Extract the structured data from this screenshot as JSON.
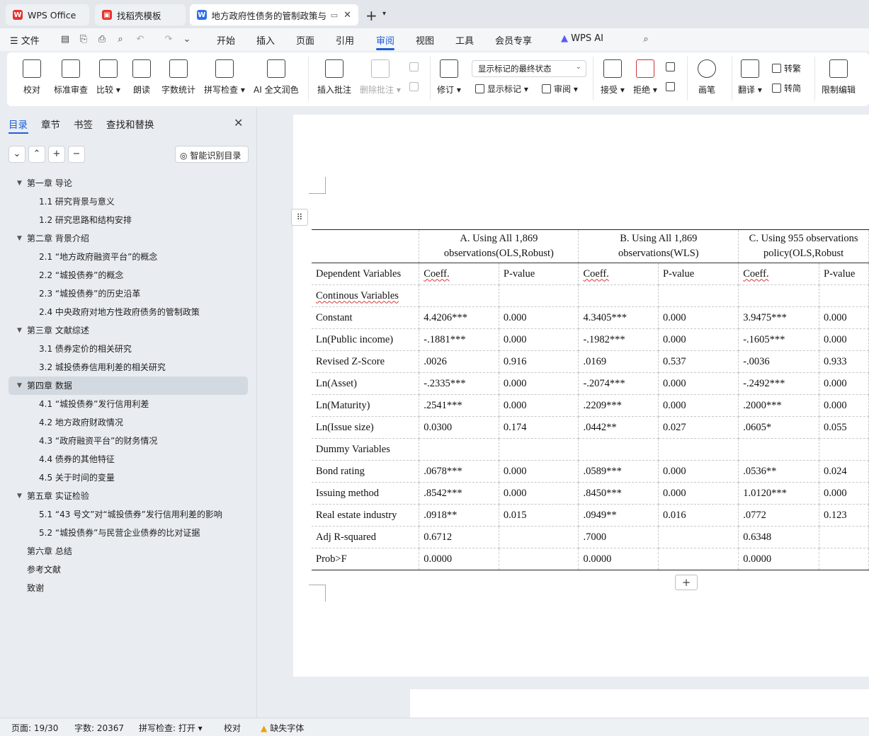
{
  "tabs": {
    "wps_office": "WPS Office",
    "template": "找稻壳模板",
    "document": "地方政府性债务的管制政策与"
  },
  "menu": {
    "file": "文件",
    "items": [
      "开始",
      "插入",
      "页面",
      "引用",
      "审阅",
      "视图",
      "工具",
      "会员专享"
    ],
    "wps_ai": "WPS AI"
  },
  "ribbon": {
    "proofread": "校对",
    "standard_review": "标准审查",
    "compare": "比较",
    "read_aloud": "朗读",
    "word_count": "字数统计",
    "spell_check": "拼写检查",
    "ai_polish": "AI 全文润色",
    "insert_comment": "插入批注",
    "delete_comment": "删除批注",
    "track_changes": "修订",
    "markup_select": "显示标记的最终状态",
    "show_markup": "显示标记",
    "review": "审阅",
    "accept": "接受",
    "reject": "拒绝",
    "brush": "画笔",
    "translate": "翻译",
    "to_traditional": "转繁",
    "to_simplified": "转简",
    "restrict_edit": "限制编辑"
  },
  "sidebar": {
    "tabs": [
      "目录",
      "章节",
      "书签",
      "查找和替换"
    ],
    "ai_toc": "智能识别目录",
    "toc": [
      {
        "level": 1,
        "text": "第一章  导论"
      },
      {
        "level": 2,
        "text": "1.1  研究背景与意义"
      },
      {
        "level": 2,
        "text": "1.2  研究思路和结构安排"
      },
      {
        "level": 1,
        "text": "第二章  背景介绍"
      },
      {
        "level": 2,
        "text": "2.1 “地方政府融资平台”的概念"
      },
      {
        "level": 2,
        "text": "2.2 “城投债券”的概念"
      },
      {
        "level": 2,
        "text": "2.3 “城投债券”的历史沿革"
      },
      {
        "level": 2,
        "text": "2.4 中央政府对地方性政府债务的管制政策"
      },
      {
        "level": 1,
        "text": "第三章  文献综述"
      },
      {
        "level": 2,
        "text": "3.1  债券定价的相关研究"
      },
      {
        "level": 2,
        "text": "3.2  城投债券信用利差的相关研究"
      },
      {
        "level": 1,
        "text": "第四章  数据",
        "selected": true
      },
      {
        "level": 2,
        "text": "4.1 “城投债券”发行信用利差"
      },
      {
        "level": 2,
        "text": "4.2 地方政府财政情况"
      },
      {
        "level": 2,
        "text": "4.3 “政府融资平台”的财务情况"
      },
      {
        "level": 2,
        "text": "4.4 债券的其他特征"
      },
      {
        "level": 2,
        "text": "4.5 关于时间的变量"
      },
      {
        "level": 1,
        "text": "第五章  实证检验"
      },
      {
        "level": 2,
        "text": "5.1 “43 号文”对“城投债券”发行信用利差的影响"
      },
      {
        "level": 2,
        "text": "5.2 “城投债券”与民营企业债券的比对证据"
      },
      {
        "level": 1,
        "text": "第六章  总结",
        "nocaret": true
      },
      {
        "level": 1,
        "text": "参考文献",
        "nocaret": true
      },
      {
        "level": 1,
        "text": "致谢",
        "nocaret": true
      }
    ]
  },
  "table": {
    "groups": [
      [
        "A.   Using All 1,869",
        "observations(OLS,Robust)"
      ],
      [
        "B.   Using All 1,869",
        "observations(WLS)"
      ],
      [
        "C.   Using 955 observations",
        "policy(OLS,Robust"
      ]
    ],
    "subheader": [
      "Dependent Variables",
      "Coeff.",
      "P-value",
      "Coeff.",
      "P-value",
      "Coeff.",
      "P-value"
    ],
    "rows": [
      [
        "Continous Variables",
        "",
        "",
        "",
        "",
        "",
        ""
      ],
      [
        "Constant",
        "4.4206***",
        "0.000",
        "4.3405***",
        "0.000",
        "3.9475***",
        "0.000"
      ],
      [
        "Ln(Public income)",
        "-.1881***",
        "0.000",
        "-.1982***",
        "0.000",
        "-.1605***",
        "0.000"
      ],
      [
        "Revised Z-Score",
        ".0026",
        "0.916",
        ".0169",
        "0.537",
        "-.0036",
        "0.933"
      ],
      [
        "Ln(Asset)",
        "-.2335***",
        "0.000",
        "-.2074***",
        "0.000",
        "-.2492***",
        "0.000"
      ],
      [
        "Ln(Maturity)",
        ".2541***",
        "0.000",
        ".2209***",
        "0.000",
        ".2000***",
        "0.000"
      ],
      [
        "Ln(Issue size)",
        "0.0300",
        "0.174",
        ".0442**",
        "0.027",
        ".0605*",
        "0.055"
      ],
      [
        "Dummy Variables",
        "",
        "",
        "",
        "",
        "",
        ""
      ],
      [
        "Bond rating",
        ".0678***",
        "0.000",
        ".0589***",
        "0.000",
        ".0536**",
        "0.024"
      ],
      [
        "Issuing method",
        ".8542***",
        "0.000",
        ".8450***",
        "0.000",
        "1.0120***",
        "0.000"
      ],
      [
        "Real estate industry",
        ".0918**",
        "0.015",
        ".0949**",
        "0.016",
        ".0772",
        "0.123"
      ],
      [
        "Adj R-squared",
        "0.6712",
        "",
        ".7000",
        "",
        "0.6348",
        ""
      ],
      [
        "Prob>F",
        "0.0000",
        "",
        "0.0000",
        "",
        "0.0000",
        ""
      ]
    ]
  },
  "status": {
    "page": "页面: 19/30",
    "words": "字数: 20367",
    "spell": "拼写检查: 打开",
    "proofread": "校对",
    "missing_font": "缺失字体"
  }
}
